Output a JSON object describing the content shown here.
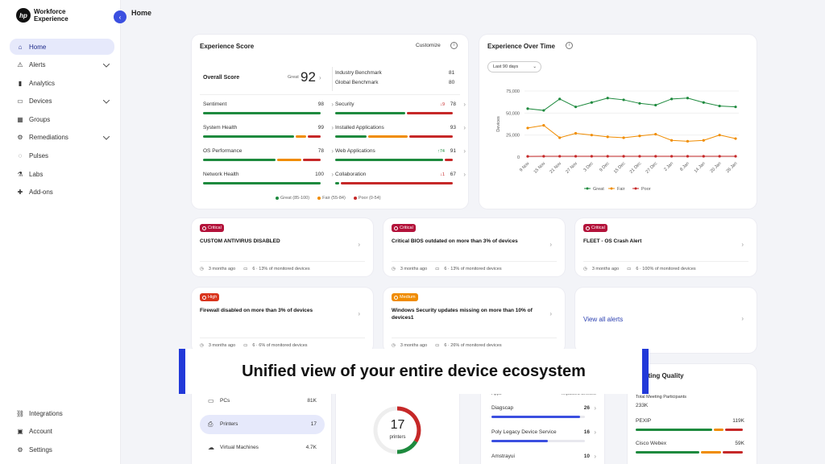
{
  "app": {
    "logo_text": "Workforce Experience",
    "logo_mark": "hp",
    "page_title": "Home"
  },
  "sidebar": {
    "items": [
      {
        "label": "Home",
        "icon": "home-icon",
        "active": true
      },
      {
        "label": "Alerts",
        "icon": "alert-icon",
        "chevron": true
      },
      {
        "label": "Analytics",
        "icon": "analytics-icon"
      },
      {
        "label": "Devices",
        "icon": "devices-icon",
        "chevron": true
      },
      {
        "label": "Groups",
        "icon": "groups-icon"
      },
      {
        "label": "Remediations",
        "icon": "remediations-icon",
        "chevron": true
      },
      {
        "label": "Pulses",
        "icon": "pulses-icon"
      },
      {
        "label": "Labs",
        "icon": "labs-icon"
      },
      {
        "label": "Add-ons",
        "icon": "addons-icon"
      }
    ],
    "bottom": [
      {
        "label": "Integrations",
        "icon": "integrations-icon"
      },
      {
        "label": "Account",
        "icon": "account-icon"
      },
      {
        "label": "Settings",
        "icon": "settings-icon"
      }
    ]
  },
  "experience_score": {
    "title": "Experience Score",
    "customize": "Customize",
    "overall_label": "Overall Score",
    "overall_rating": "Great",
    "overall_value": "92",
    "industry_label": "Industry Benchmark",
    "industry_value": "81",
    "global_label": "Global Benchmark",
    "global_value": "80",
    "metrics": [
      {
        "label": "Sentiment",
        "value": "98",
        "delta": "",
        "great": 1.0,
        "fair": 0,
        "poor": 0
      },
      {
        "label": "Security",
        "value": "78",
        "delta": "↓9",
        "great": 0.6,
        "fair": 0,
        "poor": 0.4
      },
      {
        "label": "System Health",
        "value": "99",
        "delta": "",
        "great": 0.78,
        "fair": 0.1,
        "poor": 0.12
      },
      {
        "label": "Installed Applications",
        "value": "93",
        "delta": "",
        "great": 0.28,
        "fair": 0.34,
        "poor": 0.38
      },
      {
        "label": "OS Performance",
        "value": "78",
        "delta": "",
        "great": 0.62,
        "fair": 0.22,
        "poor": 0.16
      },
      {
        "label": "Web Applications",
        "value": "91",
        "delta": "↑74",
        "great": 0.92,
        "fair": 0,
        "poor": 0.08
      },
      {
        "label": "Network Health",
        "value": "100",
        "delta": "",
        "great": 1.0,
        "fair": 0,
        "poor": 0
      },
      {
        "label": "Collaboration",
        "value": "67",
        "delta": "↓1",
        "great": 0.05,
        "fair": 0,
        "poor": 0.95
      }
    ],
    "legend": [
      {
        "label": "Great (85-100)",
        "color": "#1e8a3e"
      },
      {
        "label": "Fair (55-84)",
        "color": "#f08c00"
      },
      {
        "label": "Poor (0-54)",
        "color": "#c62828"
      }
    ]
  },
  "experience_time": {
    "title": "Experience Over Time",
    "range": "Last 90 days",
    "chart_data": {
      "type": "line",
      "ylabel": "Devices",
      "ylim": [
        0,
        75000
      ],
      "yticks": [
        "75,000",
        "50,000",
        "25,000",
        "0"
      ],
      "categories": [
        "9 Nov",
        "15 Nov",
        "21 Nov",
        "27 Nov",
        "3 Dec",
        "9 Dec",
        "15 Dec",
        "21 Dec",
        "27 Dec",
        "2 Jan",
        "8 Jan",
        "14 Jan",
        "20 Jan",
        "26 Jan"
      ],
      "series": [
        {
          "name": "Great",
          "color": "#1e8a3e",
          "values": [
            55000,
            53000,
            66000,
            57000,
            62000,
            67000,
            65000,
            61000,
            59000,
            66000,
            67000,
            62000,
            58000,
            57000
          ]
        },
        {
          "name": "Fair",
          "color": "#f08c00",
          "values": [
            33000,
            36000,
            22000,
            27000,
            25000,
            23000,
            22000,
            24000,
            26000,
            19000,
            18000,
            19000,
            25000,
            21000
          ]
        },
        {
          "name": "Poor",
          "color": "#c62828",
          "values": [
            800,
            900,
            900,
            900,
            900,
            900,
            900,
            900,
            900,
            900,
            900,
            900,
            900,
            900
          ]
        }
      ],
      "legend": [
        "Great",
        "Fair",
        "Poor"
      ]
    }
  },
  "alerts": [
    {
      "severity": "Critical",
      "color": "#b3123a",
      "title": "CUSTOM ANTIVIRUS DISABLED",
      "time": "3 months ago",
      "devices": "6 · 13% of monitored devices"
    },
    {
      "severity": "Critical",
      "color": "#b3123a",
      "title": "Critical BIOS outdated on more than 3% of devices",
      "time": "3 months ago",
      "devices": "6 · 13% of monitored devices"
    },
    {
      "severity": "Critical",
      "color": "#b3123a",
      "title": "FLEET - OS Crash Alert",
      "time": "3 months ago",
      "devices": "6 · 100% of monitored devices"
    },
    {
      "severity": "High",
      "color": "#d9341c",
      "title": "Firewall disabled on more than 3% of devices",
      "time": "3 months ago",
      "devices": "6 · 6% of monitored devices"
    },
    {
      "severity": "Medium",
      "color": "#f08c00",
      "title": "Windows Security updates missing on more than 10% of devices1",
      "time": "3 months ago",
      "devices": "6 · 26% of monitored devices"
    }
  ],
  "view_all_alerts": "View all alerts",
  "banner": "Unified view of your entire device ecosystem",
  "devices_card": {
    "items": [
      {
        "label": "PCs",
        "value": "81K"
      },
      {
        "label": "Printers",
        "value": "17",
        "active": true
      },
      {
        "label": "Virtual Machines",
        "value": "4.7K"
      }
    ],
    "donut_value": "17",
    "donut_label": "printers"
  },
  "apps_card": {
    "col_left": "Apps",
    "col_right": "Impacted devices",
    "items": [
      {
        "label": "Diagscap",
        "value": "26",
        "fill": 0.95
      },
      {
        "label": "Poly Legacy Device Service",
        "value": "16",
        "fill": 0.6
      },
      {
        "label": "Amstrayui",
        "value": "10",
        "fill": 0.35
      }
    ]
  },
  "meeting_card": {
    "title": "Meeting Quality",
    "total_label": "Total Meeting Participants",
    "total_value": "233K",
    "items": [
      {
        "label": "PEXIP",
        "value": "119K",
        "great": 0.72,
        "fair": 0.1,
        "poor": 0.18
      },
      {
        "label": "Cisco Webex",
        "value": "59K",
        "great": 0.6,
        "fair": 0.2,
        "poor": 0.2
      }
    ]
  }
}
